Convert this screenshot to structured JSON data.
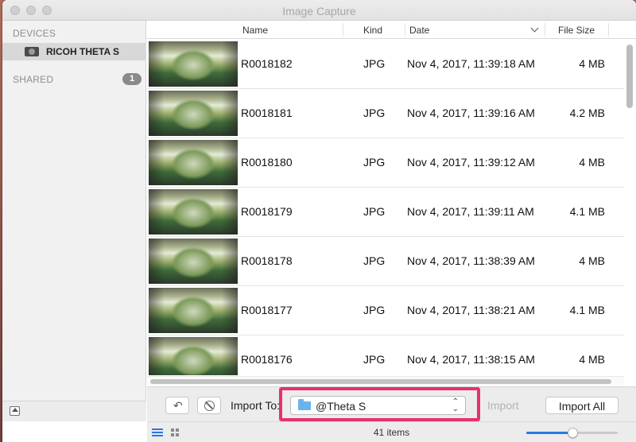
{
  "window": {
    "title": "Image Capture"
  },
  "sidebar": {
    "devices_heading": "DEVICES",
    "device_name": "RICOH THETA S",
    "shared_heading": "SHARED",
    "shared_count": "1"
  },
  "columns": {
    "name": "Name",
    "kind": "Kind",
    "date": "Date",
    "size": "File Size"
  },
  "files": [
    {
      "name": "R0018182",
      "kind": "JPG",
      "date": "Nov 4, 2017, 11:39:18 AM",
      "size": "4 MB"
    },
    {
      "name": "R0018181",
      "kind": "JPG",
      "date": "Nov 4, 2017, 11:39:16 AM",
      "size": "4.2 MB"
    },
    {
      "name": "R0018180",
      "kind": "JPG",
      "date": "Nov 4, 2017, 11:39:12 AM",
      "size": "4 MB"
    },
    {
      "name": "R0018179",
      "kind": "JPG",
      "date": "Nov 4, 2017, 11:39:11 AM",
      "size": "4.1 MB"
    },
    {
      "name": "R0018178",
      "kind": "JPG",
      "date": "Nov 4, 2017, 11:38:39 AM",
      "size": "4 MB"
    },
    {
      "name": "R0018177",
      "kind": "JPG",
      "date": "Nov 4, 2017, 11:38:21 AM",
      "size": "4.1 MB"
    },
    {
      "name": "R0018176",
      "kind": "JPG",
      "date": "Nov 4, 2017, 11:38:15 AM",
      "size": "4 MB"
    }
  ],
  "toolbar": {
    "import_to_label": "Import To:",
    "destination": "@Theta S",
    "import_label": "Import",
    "import_all_label": "Import All",
    "highlight_color": "#e5316e"
  },
  "status": {
    "items_count": "41 items",
    "thumbnail_size_level": 0.5
  },
  "colors": {
    "accent": "#2a78e0",
    "folder": "#6ab4ee"
  }
}
